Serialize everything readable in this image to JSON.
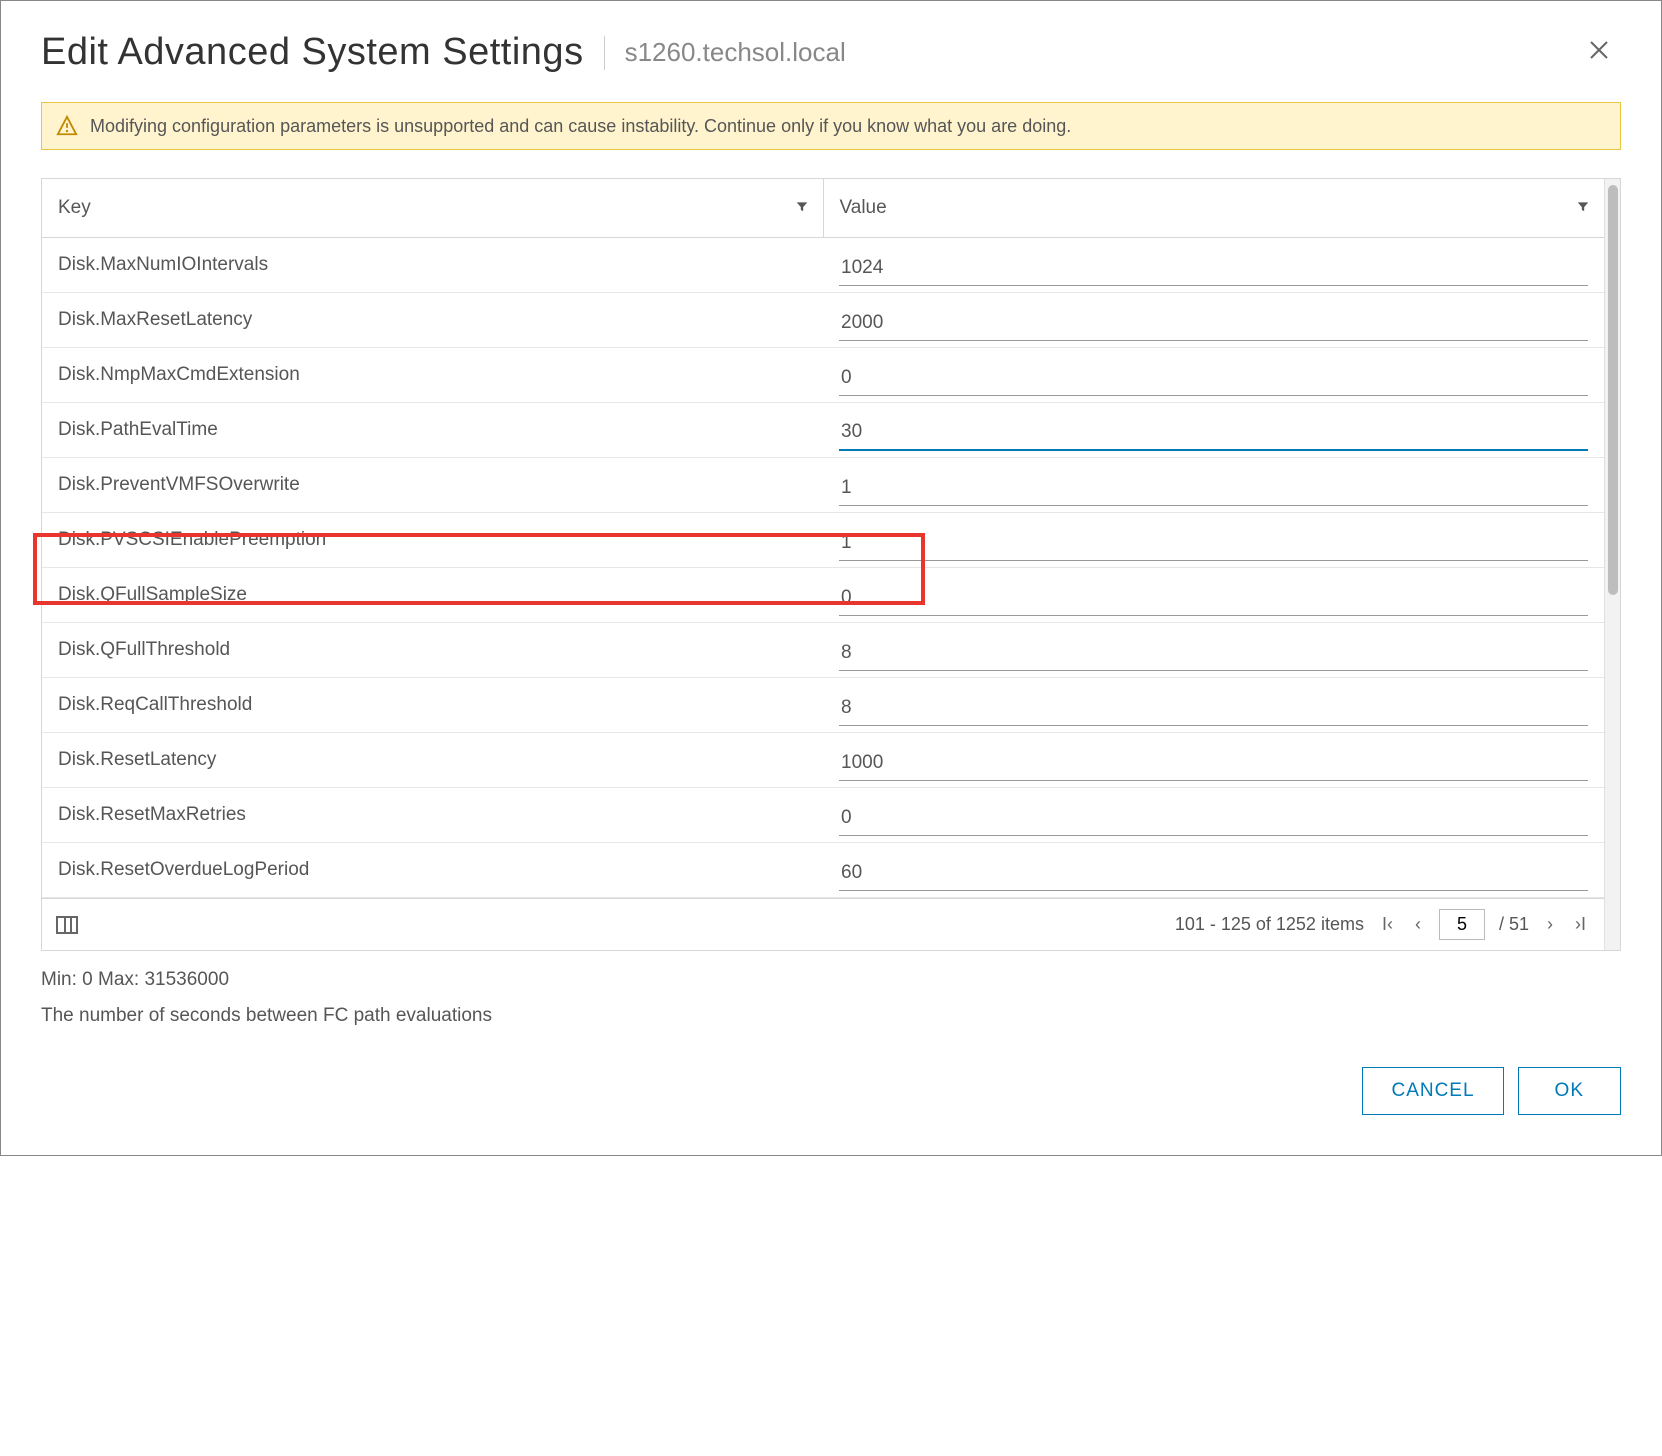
{
  "header": {
    "title": "Edit Advanced System Settings",
    "subtitle": "s1260.techsol.local"
  },
  "alert": {
    "text": "Modifying configuration parameters is unsupported and can cause instability. Continue only if you know what you are doing."
  },
  "columns": {
    "key": "Key",
    "value": "Value"
  },
  "rows": [
    {
      "key": "Disk.MaxNumIOIntervals",
      "value": "1024"
    },
    {
      "key": "Disk.MaxResetLatency",
      "value": "2000"
    },
    {
      "key": "Disk.NmpMaxCmdExtension",
      "value": "0"
    },
    {
      "key": "Disk.PathEvalTime",
      "value": "30",
      "highlighted": true
    },
    {
      "key": "Disk.PreventVMFSOverwrite",
      "value": "1"
    },
    {
      "key": "Disk.PVSCSIEnablePreemption",
      "value": "1"
    },
    {
      "key": "Disk.QFullSampleSize",
      "value": "0"
    },
    {
      "key": "Disk.QFullThreshold",
      "value": "8"
    },
    {
      "key": "Disk.ReqCallThreshold",
      "value": "8"
    },
    {
      "key": "Disk.ResetLatency",
      "value": "1000"
    },
    {
      "key": "Disk.ResetMaxRetries",
      "value": "0"
    },
    {
      "key": "Disk.ResetOverdueLogPeriod",
      "value": "60"
    }
  ],
  "pager": {
    "summary": "101 - 125 of 1252 items",
    "page": "5",
    "total_pages": "51"
  },
  "detail": {
    "range": "Min: 0 Max: 31536000",
    "description": "The number of seconds between FC path evaluations"
  },
  "buttons": {
    "cancel": "CANCEL",
    "ok": "OK"
  }
}
